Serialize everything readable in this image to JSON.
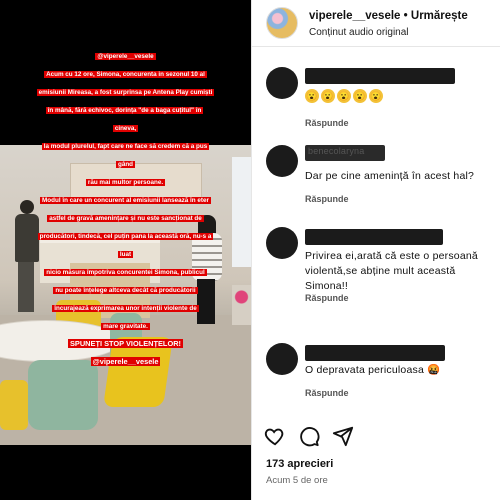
{
  "post": {
    "caption_lines": [
      "@viperele__vesele",
      "Acum cu 12 ore, Simona, concurenta in sezonul 10 al",
      "emisiunii Mireasa, a fost surprinsa pe Antena Play cumiști",
      "în mână, fără echivoc, dorința \"de a baga cuțitul\" în cineva,",
      "la modul plurelul, fapt care ne face să credem că a pus gând",
      "rău mai multor persoane.",
      "Modul în care un concurent al emisiunii lansează în eter",
      "astfel de gravă amenințare și nu este sancționat de",
      "producători, tindecă, cel puțin pana la această oră, nu-s a luat",
      "nicio măsura împotriva concurentei Simona, publicul",
      "nu poate înțelege altceva decât că producătorii",
      "încurajează exprimarea unor intenții violente de",
      "mare gravitate."
    ],
    "caption_end": "SPUNEȚI STOP VIOLENȚELOR!",
    "caption_handle": "@viperele__vesele"
  },
  "header": {
    "handle": "viperele__vesele",
    "separator": "•",
    "follow_label": "Urmărește",
    "subtitle": "Conținut audio original"
  },
  "comments": [
    {
      "name_redacted": true,
      "text": "",
      "emoji": [
        "😮",
        "😮",
        "😮",
        "😮",
        "😮"
      ],
      "reply_label": "Răspunde"
    },
    {
      "name_partial": "benecolaryna",
      "text": "Dar pe cine amenință în acest hal?",
      "reply_label": "Răspunde"
    },
    {
      "name_redacted": true,
      "text": "Privirea ei,arată că este o persoană violentă,se abține mult această Simona!!",
      "reply_label": "Răspunde"
    },
    {
      "name_redacted": true,
      "text": "O depravata periculoasa 🤬",
      "reply_label": "Răspunde"
    }
  ],
  "footer": {
    "likes": "173 aprecieri",
    "time": "Acum 5 de ore"
  },
  "icons": [
    "heart-icon",
    "comment-icon",
    "share-icon"
  ]
}
